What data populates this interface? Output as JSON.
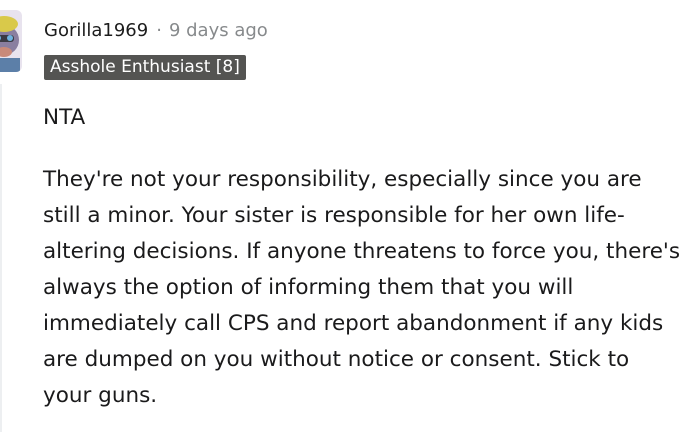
{
  "comment": {
    "author": "Gorilla1969",
    "separator": "·",
    "timestamp": "9 days ago",
    "flair": "Asshole Enthusiast [8]",
    "body": [
      "NTA",
      "They're not your responsibility, especially since you are still a minor. Your sister is responsible for her own life-altering decisions. If anyone threatens to force you, there's always the option of informing them that you will immediately call CPS and report abandonment if any kids are dumped on you without notice or consent. Stick to your guns."
    ]
  },
  "colors": {
    "flair_background": "#545452",
    "meta_text": "#878a8c",
    "body_text": "#1a1a1b"
  }
}
